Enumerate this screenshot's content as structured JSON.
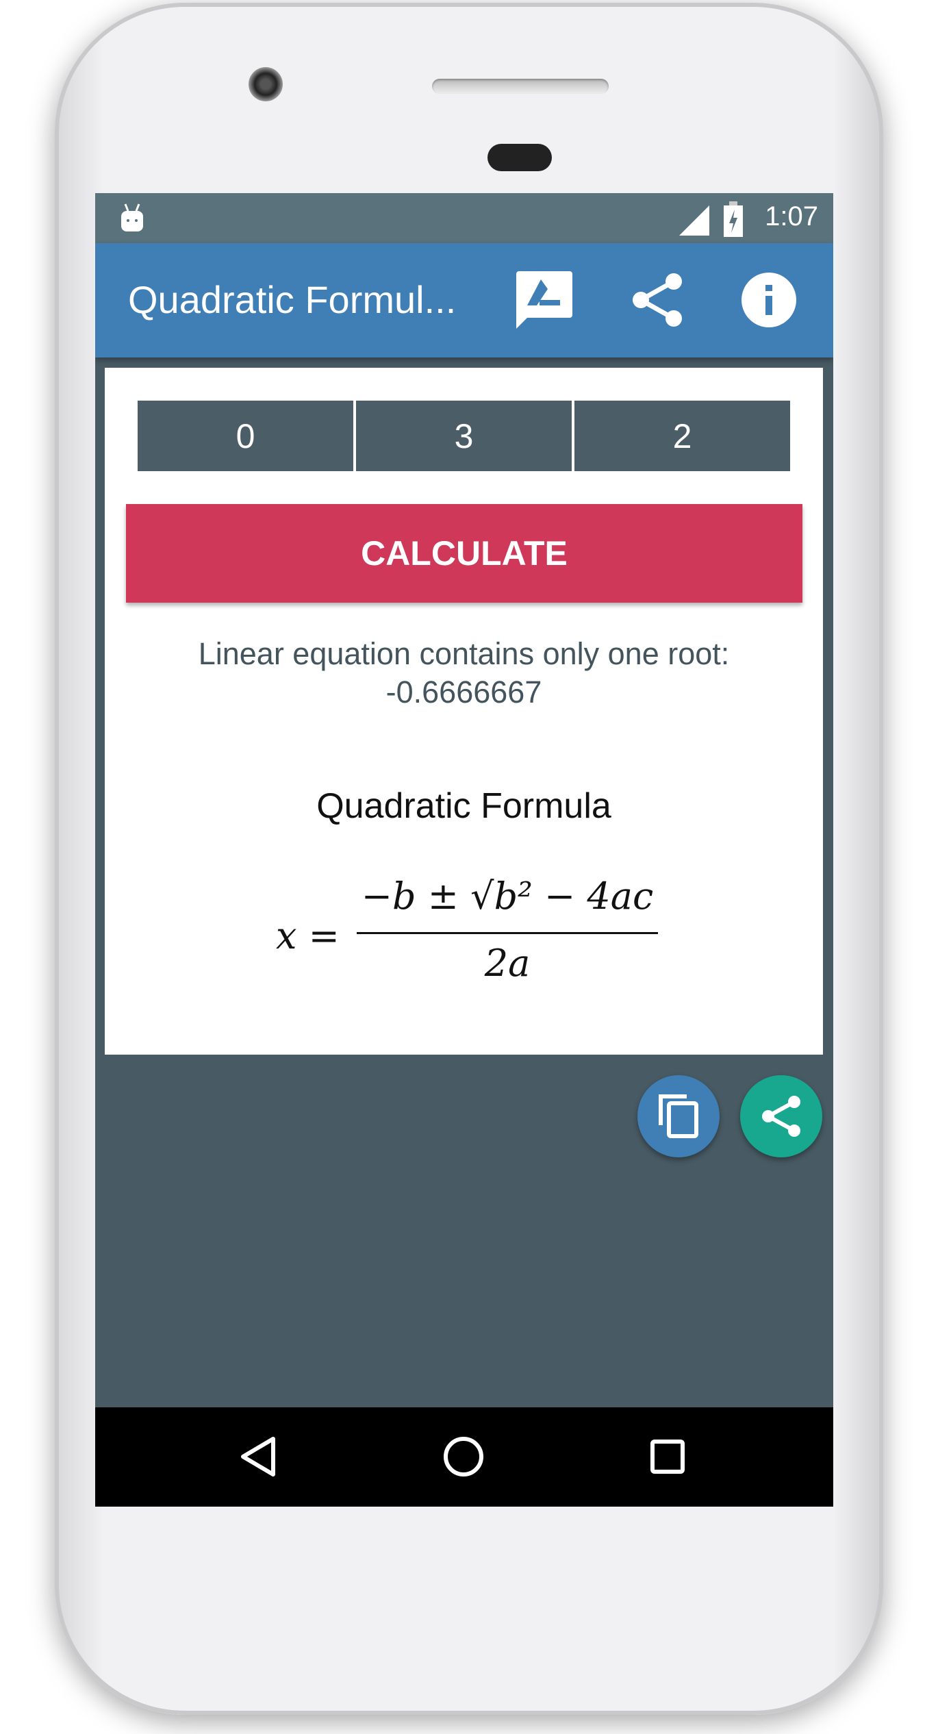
{
  "status_bar": {
    "time": "1:07",
    "icons": [
      "android-icon",
      "signal-icon",
      "battery-charging-icon"
    ]
  },
  "app_bar": {
    "title": "Quadratic Formul...",
    "actions": [
      "feedback-edit-icon",
      "share-icon",
      "info-icon"
    ]
  },
  "inputs": {
    "a": "0",
    "b": "3",
    "c": "2"
  },
  "calculate_button": {
    "label": "CALCULATE",
    "color": "#d0385a"
  },
  "result": {
    "line1": "Linear equation contains only one root:",
    "line2": "-0.6666667"
  },
  "formula": {
    "title": "Quadratic Formula",
    "lhs": "x =",
    "numerator": "−b ± √b² − 4ac",
    "denominator": "2a"
  },
  "fabs": {
    "copy": {
      "icon": "copy-icon",
      "color": "#3f7fb6"
    },
    "share": {
      "icon": "share-icon",
      "color": "#17a88f"
    }
  },
  "nav_bar": {
    "icons": [
      "back-icon",
      "home-icon",
      "recents-icon"
    ]
  },
  "colors": {
    "app_bar": "#3f7fb6",
    "status_bar": "#5a727c",
    "background": "#485a63",
    "input_cells": "#4b5d66"
  }
}
